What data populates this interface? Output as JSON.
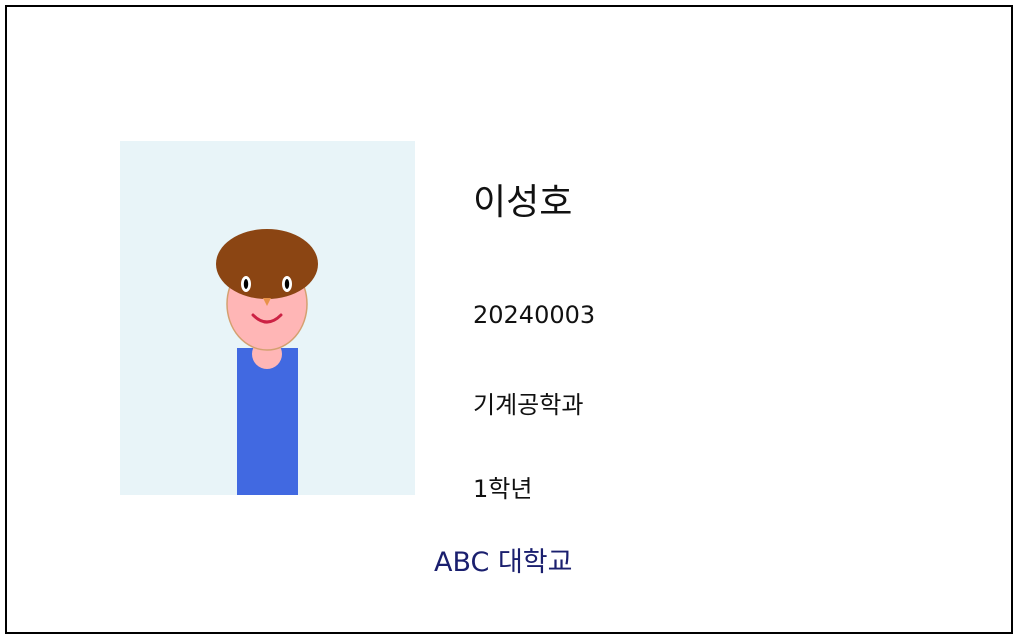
{
  "student": {
    "name": "이성호",
    "student_id": "20240003",
    "department": "기계공학과",
    "grade": "1학년"
  },
  "university": "ABC 대학교",
  "colors": {
    "photo_background": "#e8f4f8",
    "hair": "#8b4513",
    "skin": "#ffb6b6",
    "shirt": "#4169e1",
    "mouth": "#cc2244",
    "university_text": "#1a1f6e"
  }
}
